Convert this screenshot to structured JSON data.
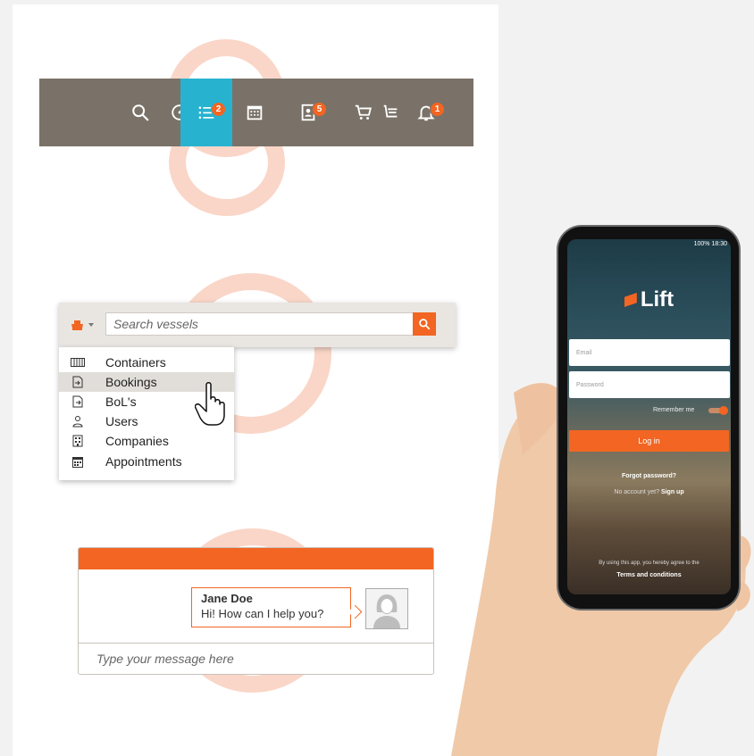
{
  "toolbar": {
    "items": [
      {
        "icon": "search-icon"
      },
      {
        "icon": "dashboard-icon"
      },
      {
        "icon": "list-icon",
        "badge": "2",
        "active": true
      },
      {
        "icon": "calendar-icon"
      },
      {
        "icon": "contacts-icon",
        "badge": "5"
      },
      {
        "icon": "cart-icon"
      },
      {
        "icon": "bell-icon",
        "badge": "1"
      }
    ]
  },
  "search": {
    "placeholder": "Search vessels"
  },
  "menu": {
    "items": [
      {
        "label": "Containers",
        "icon": "containers-icon"
      },
      {
        "label": "Bookings",
        "icon": "bookings-icon",
        "hover": true
      },
      {
        "label": "BoL's",
        "icon": "document-icon"
      },
      {
        "label": "Users",
        "icon": "user-icon"
      },
      {
        "label": "Companies",
        "icon": "building-icon"
      },
      {
        "label": "Appointments",
        "icon": "calendar-icon"
      }
    ]
  },
  "chat": {
    "agent_name": "Jane Doe",
    "message": "Hi! How can I help you?",
    "input_placeholder": "Type your message here"
  },
  "phone": {
    "status": "100% 18:30",
    "app_name": "Lift",
    "email_placeholder": "Email",
    "password_placeholder": "Password",
    "remember_label": "Remember me",
    "login_label": "Log in",
    "forgot_label": "Forgot password?",
    "no_account": "No account yet?",
    "signup_label": "Sign up",
    "terms_prefix": "By using this app, you hereby agree to the",
    "terms_link": "Terms and conditions"
  },
  "colors": {
    "accent": "#f26522",
    "toolbar_bg": "#7a7268",
    "toolbar_active": "#27b3cf",
    "ring": "#fad6c8"
  }
}
